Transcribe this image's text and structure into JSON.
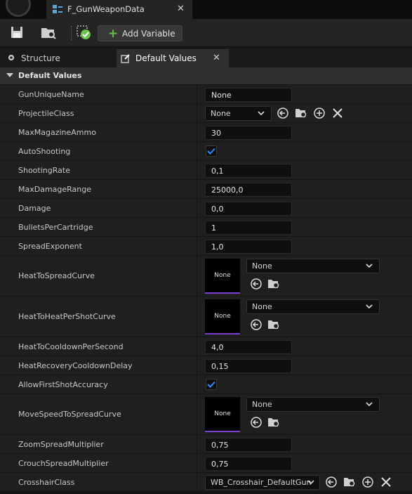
{
  "document_tab": {
    "title": "F_GunWeaponData",
    "close": "✕"
  },
  "toolbar": {
    "add_variable_label": "Add Variable"
  },
  "panel_tabs": [
    {
      "label": "Structure"
    },
    {
      "label": "Default Values",
      "close": "✕"
    }
  ],
  "section": {
    "title": "Default Values"
  },
  "properties": {
    "gun_unique_name": {
      "label": "GunUniqueName",
      "value": "None"
    },
    "projectile_class": {
      "label": "ProjectileClass",
      "value": "None"
    },
    "max_magazine_ammo": {
      "label": "MaxMagazineAmmo",
      "value": "30"
    },
    "auto_shooting": {
      "label": "AutoShooting",
      "checked": true
    },
    "shooting_rate": {
      "label": "ShootingRate",
      "value": "0,1"
    },
    "max_damage_range": {
      "label": "MaxDamageRange",
      "value": "25000,0"
    },
    "damage": {
      "label": "Damage",
      "value": "0,0"
    },
    "bullets_per_cartridge": {
      "label": "BulletsPerCartridge",
      "value": "1"
    },
    "spread_exponent": {
      "label": "SpreadExponent",
      "value": "1,0"
    },
    "heat_to_spread_curve": {
      "label": "HeatToSpreadCurve",
      "thumb": "None",
      "value": "None"
    },
    "heat_to_heat_per_shot_curve": {
      "label": "HeatToHeatPerShotCurve",
      "thumb": "None",
      "value": "None"
    },
    "heat_to_cooldown_per_second": {
      "label": "HeatToCooldownPerSecond",
      "value": "4,0"
    },
    "heat_recovery_cooldown_delay": {
      "label": "HeatRecoveryCooldownDelay",
      "value": "0,15"
    },
    "allow_first_shot_accuracy": {
      "label": "AllowFirstShotAccuracy",
      "checked": true
    },
    "move_speed_to_spread_curve": {
      "label": "MoveSpeedToSpreadCurve",
      "thumb": "None",
      "value": "None"
    },
    "zoom_spread_multiplier": {
      "label": "ZoomSpreadMultiplier",
      "value": "0,75"
    },
    "crouch_spread_multiplier": {
      "label": "CrouchSpreadMultiplier",
      "value": "0,75"
    },
    "crosshair_class": {
      "label": "CrosshairClass",
      "value": "WB_Crosshair_DefaultGun"
    }
  },
  "icons": {
    "save": "save-icon",
    "browse": "browse-icon",
    "compile": "compile-icon",
    "use_selected": "use-selected-icon",
    "browse_asset": "browse-asset-icon",
    "add": "add-icon",
    "clear": "clear-icon",
    "dropdown": "chevron-down-icon"
  },
  "colors": {
    "checkbox_check": "#2a8cff",
    "add_plus": "#64c24a",
    "curve_underline": "#7a3fd0",
    "compile_ok": "#6cc24a"
  }
}
